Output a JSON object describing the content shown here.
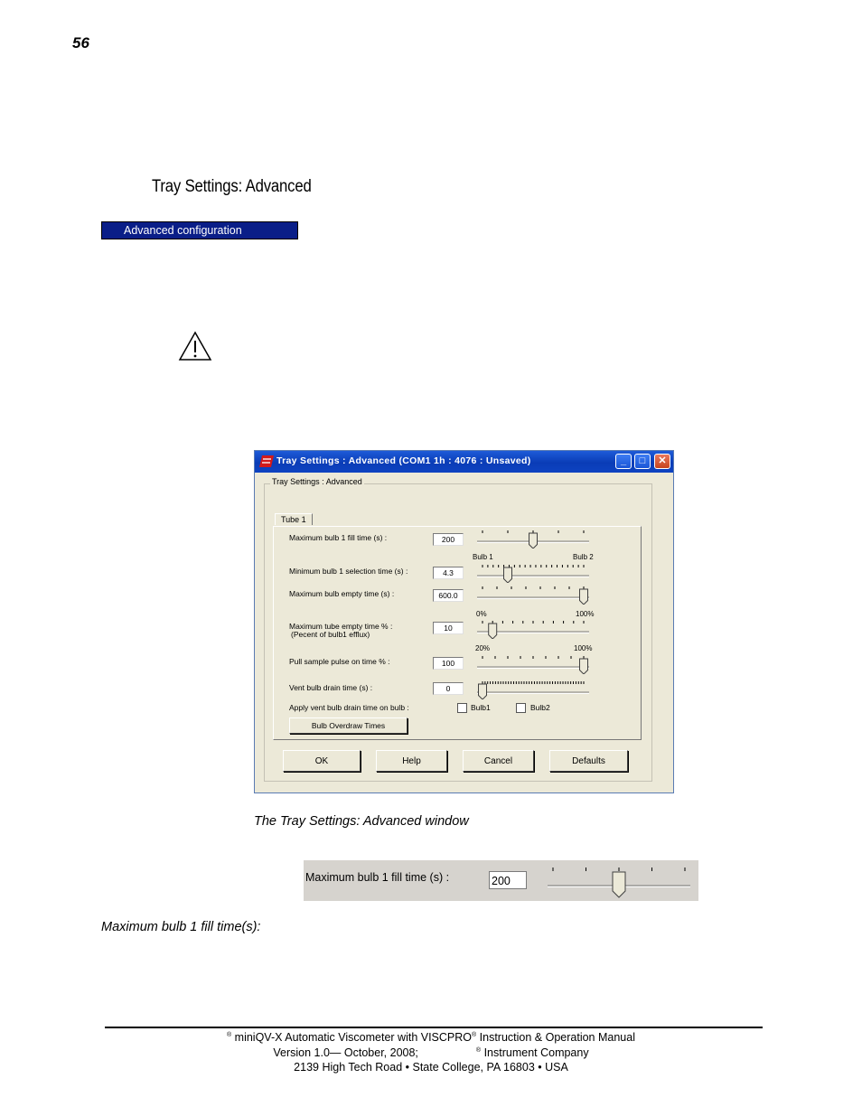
{
  "page": {
    "number": "56",
    "section_heading": "Tray Settings: Advanced",
    "menu_item": "Advanced configuration",
    "caption_window": "The Tray Settings: Advanced window",
    "caption_fill": "Maximum bulb 1 fill time(s):"
  },
  "icons": {
    "warning": "warning-triangle-icon"
  },
  "dialog": {
    "title": "Tray Settings : Advanced (COM1 1h : 4076 : Unsaved)",
    "group_label": "Tray Settings : Advanced",
    "tab_label": "Tube 1",
    "rows": {
      "max_fill": {
        "label": "Maximum bulb 1 fill time  (s) :",
        "value": "200",
        "slider_fraction": 0.5
      },
      "min_select": {
        "label": "Minimum bulb 1 selection time  (s) :",
        "value": "4.3",
        "left_label": "Bulb 1",
        "right_label": "Bulb 2",
        "slider_fraction": 0.25
      },
      "max_empty": {
        "label": "Maximum bulb empty time  (s) :",
        "value": "600.0",
        "slider_fraction": 1.0
      },
      "tube_empty": {
        "label": "Maximum tube empty time % :",
        "label2": "(Pecent of bulb1 efflux)",
        "value": "10",
        "left_label": "0%",
        "right_label": "100%",
        "slider_fraction": 0.1
      },
      "pull_sample": {
        "label": "Pull sample pulse on time % :",
        "value": "100",
        "left_label": "20%",
        "right_label": "100%",
        "slider_fraction": 1.0
      },
      "vent_drain": {
        "label": "Vent bulb drain time (s) :",
        "value": "0",
        "slider_fraction": 0.0
      },
      "apply_vent": {
        "label": "Apply vent bulb drain time on bulb :",
        "bulb1": "Bulb1",
        "bulb2": "Bulb2",
        "bulb1_checked": false,
        "bulb2_checked": false
      }
    },
    "overdraw_button": "Bulb Overdraw Times",
    "buttons": {
      "ok": "OK",
      "help": "Help",
      "cancel": "Cancel",
      "defaults": "Defaults"
    }
  },
  "zoom": {
    "label": "Maximum bulb 1 fill time  (s) :",
    "value": "200",
    "slider_fraction": 0.5
  },
  "footer": {
    "line1_a": "®",
    "line1_b": " miniQV-X Automatic Viscometer with VISCPRO",
    "line1_c": "®",
    "line1_d": " Instruction & Operation Manual",
    "line2_a": "Version 1.0— October, 2008;",
    "line2_b": "®",
    "line2_c": " Instrument Company",
    "line3": "2139 High Tech Road • State College, PA  16803 • USA"
  }
}
